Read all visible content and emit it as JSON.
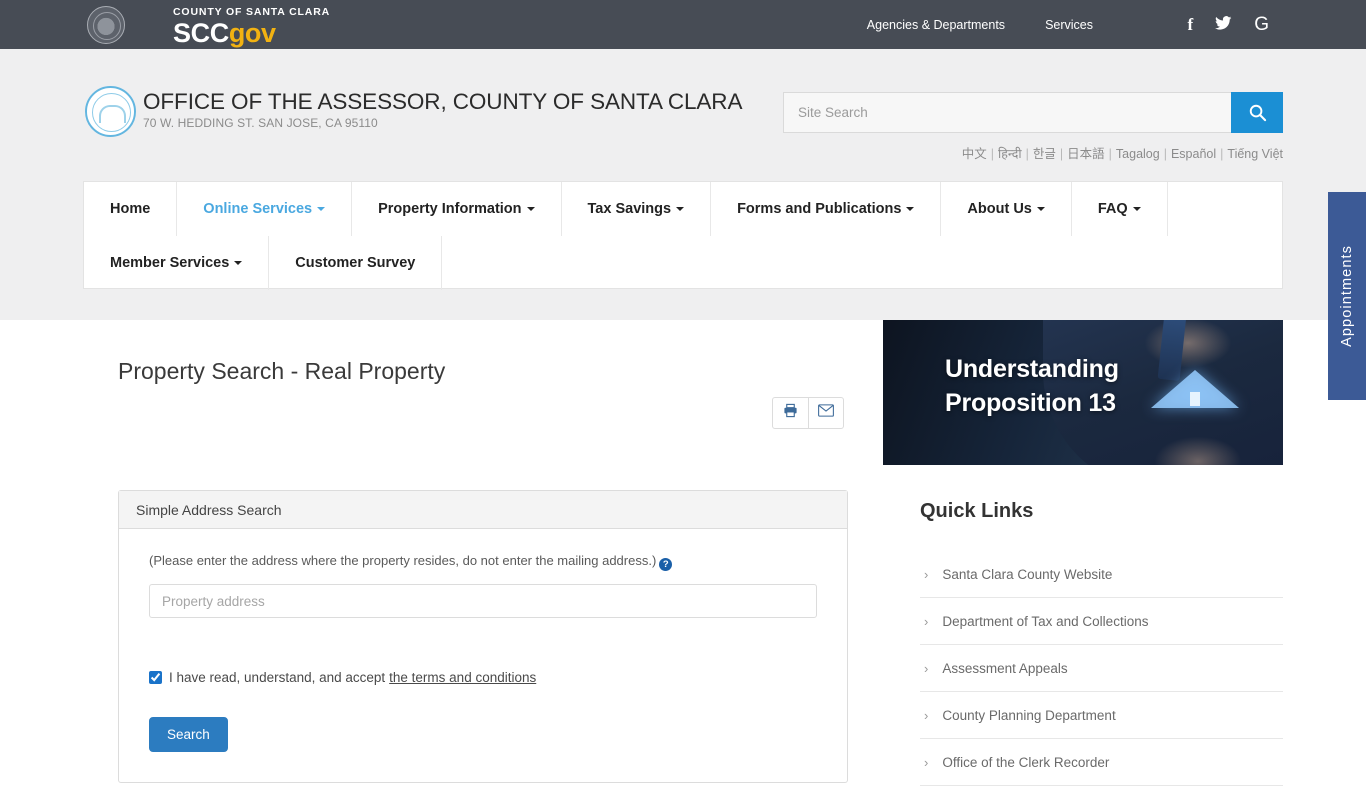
{
  "gov_bar": {
    "county_label": "COUNTY OF SANTA CLARA",
    "logo_scc": "SCC",
    "logo_gov": "gov",
    "links": [
      {
        "label": "Agencies & Departments"
      },
      {
        "label": "Services"
      }
    ],
    "social": [
      {
        "name": "facebook-icon",
        "glyph": "f"
      },
      {
        "name": "twitter-icon",
        "glyph": "🐦"
      },
      {
        "name": "google-icon",
        "glyph": "G"
      }
    ]
  },
  "header": {
    "title": "OFFICE OF THE ASSESSOR, COUNTY OF SANTA CLARA",
    "address": "70 W. HEDDING ST. SAN JOSE, CA 95110",
    "search_placeholder": "Site Search",
    "search_value": "",
    "languages": [
      "中文",
      "हिन्दी",
      "한글",
      "日本語",
      "Tagalog",
      "Español",
      "Tiếng Việt"
    ]
  },
  "nav": {
    "items": [
      {
        "label": "Home",
        "caret": false,
        "active": false
      },
      {
        "label": "Online Services",
        "caret": true,
        "active": true
      },
      {
        "label": "Property Information",
        "caret": true,
        "active": false
      },
      {
        "label": "Tax Savings",
        "caret": true,
        "active": false
      },
      {
        "label": "Forms and Publications",
        "caret": true,
        "active": false
      },
      {
        "label": "About Us",
        "caret": true,
        "active": false
      },
      {
        "label": "FAQ",
        "caret": true,
        "active": false
      },
      {
        "label": "Member Services",
        "caret": true,
        "active": false
      },
      {
        "label": "Customer Survey",
        "caret": false,
        "active": false
      }
    ]
  },
  "main": {
    "page_title": "Property Search - Real Property",
    "actions": [
      {
        "name": "print-icon",
        "label": "Print"
      },
      {
        "name": "email-icon",
        "label": "Email"
      }
    ],
    "panel": {
      "heading": "Simple Address Search",
      "hint": "(Please enter the address where the property resides, do not enter the mailing address.)",
      "help_glyph": "?",
      "address_placeholder": "Property address",
      "address_value": "",
      "terms_text": "I have read, understand, and accept",
      "terms_link": "the terms and conditions",
      "terms_checked": true,
      "search_label": "Search"
    }
  },
  "sidebar": {
    "banner": {
      "line1": "Understanding",
      "line2": "Proposition 13"
    },
    "quick_links_title": "Quick Links",
    "quick_links": [
      {
        "label": "Santa Clara County Website"
      },
      {
        "label": "Department of Tax and Collections"
      },
      {
        "label": "Assessment Appeals"
      },
      {
        "label": "County Planning Department"
      },
      {
        "label": "Office of the Clerk Recorder"
      }
    ]
  },
  "appointments_tab": {
    "label": "Appointments"
  },
  "colors": {
    "gov_bar": "#474c55",
    "gov_accent": "#f2b212",
    "nav_active": "#4aa8e0",
    "search_button": "#1b8fd4",
    "primary_button": "#2c7cc0",
    "appointments_tab": "#3c5a96"
  }
}
